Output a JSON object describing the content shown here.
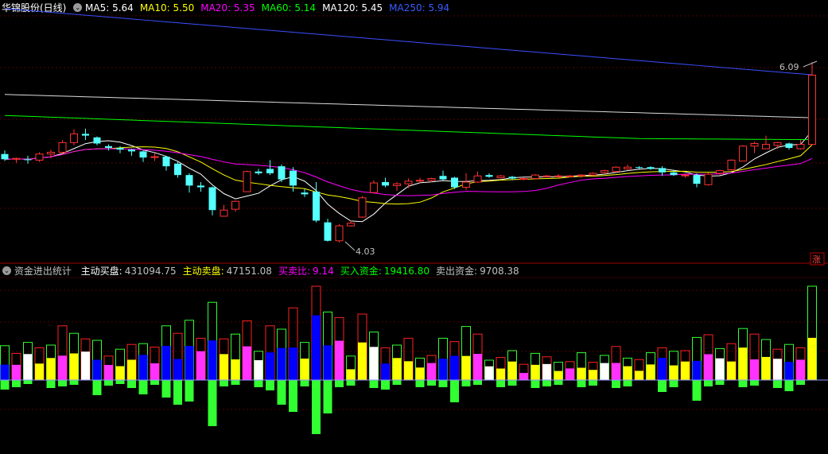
{
  "main_panel": {
    "title": "华锦股份(日线)",
    "ma_indicators": [
      {
        "label": "MA5: 5.64",
        "color": "#ffffff"
      },
      {
        "label": "MA10: 5.50",
        "color": "#ffff00"
      },
      {
        "label": "MA20: 5.35",
        "color": "#ff00ff"
      },
      {
        "label": "MA60: 5.14",
        "color": "#00ff00"
      },
      {
        "label": "MA120: 5.45",
        "color": "#ffffff"
      },
      {
        "label": "MA250: 5.94",
        "color": "#3a5bff"
      }
    ],
    "high_label": "6.09",
    "low_label": "4.03",
    "rise_badge": "涨"
  },
  "sub_panel": {
    "title": "资金进出统计",
    "indicators": [
      {
        "label": "主动买盘:",
        "value": "431094.75",
        "label_color": "#ffffff",
        "value_color": "#c0c0c0"
      },
      {
        "label": "主动卖盘:",
        "value": "47151.08",
        "label_color": "#ffff00",
        "value_color": "#c0c0c0"
      },
      {
        "label": "买卖比:",
        "value": "9.14",
        "label_color": "#ff00ff",
        "value_color": "#ff00ff"
      },
      {
        "label": "买入资金:",
        "value": "19416.80",
        "label_color": "#00ff00",
        "value_color": "#00ff00"
      },
      {
        "label": "卖出资金:",
        "value": "9708.38",
        "label_color": "#c0c0c0",
        "value_color": "#c0c0c0"
      }
    ]
  },
  "chart_data": {
    "type": "candlestick",
    "ohlc": [
      [
        5.04,
        5.08,
        4.96,
        4.98
      ],
      [
        4.98,
        5.0,
        4.94,
        4.99
      ],
      [
        4.98,
        5.02,
        4.93,
        4.97
      ],
      [
        4.97,
        5.06,
        4.95,
        5.04
      ],
      [
        5.04,
        5.09,
        4.99,
        5.06
      ],
      [
        5.06,
        5.2,
        5.03,
        5.17
      ],
      [
        5.17,
        5.32,
        5.14,
        5.27
      ],
      [
        5.27,
        5.33,
        5.2,
        5.25
      ],
      [
        5.23,
        5.24,
        5.14,
        5.16
      ],
      [
        5.13,
        5.15,
        5.08,
        5.11
      ],
      [
        5.11,
        5.13,
        5.05,
        5.09
      ],
      [
        5.09,
        5.1,
        5.02,
        5.07
      ],
      [
        5.07,
        5.08,
        4.95,
        5.0
      ],
      [
        5.0,
        5.05,
        4.96,
        5.01
      ],
      [
        5.01,
        5.02,
        4.85,
        4.9
      ],
      [
        4.93,
        4.95,
        4.77,
        4.8
      ],
      [
        4.8,
        4.82,
        4.6,
        4.68
      ],
      [
        4.68,
        4.72,
        4.61,
        4.66
      ],
      [
        4.66,
        4.67,
        4.34,
        4.4
      ],
      [
        4.33,
        4.46,
        4.33,
        4.4
      ],
      [
        4.41,
        4.51,
        4.38,
        4.5
      ],
      [
        4.61,
        4.85,
        4.61,
        4.84
      ],
      [
        4.84,
        4.87,
        4.8,
        4.82
      ],
      [
        4.87,
        4.97,
        4.8,
        4.82
      ],
      [
        4.9,
        4.92,
        4.72,
        4.75
      ],
      [
        4.85,
        4.89,
        4.61,
        4.68
      ],
      [
        4.6,
        4.64,
        4.55,
        4.58
      ],
      [
        4.61,
        4.72,
        4.26,
        4.28
      ],
      [
        4.26,
        4.3,
        4.04,
        4.05
      ],
      [
        4.05,
        4.24,
        4.03,
        4.22
      ],
      [
        4.22,
        4.28,
        4.21,
        4.25
      ],
      [
        4.32,
        4.56,
        4.31,
        4.54
      ],
      [
        4.6,
        4.74,
        4.6,
        4.71
      ],
      [
        4.72,
        4.77,
        4.66,
        4.68
      ],
      [
        4.68,
        4.72,
        4.62,
        4.7
      ],
      [
        4.7,
        4.76,
        4.65,
        4.73
      ],
      [
        4.73,
        4.77,
        4.71,
        4.74
      ],
      [
        4.74,
        4.77,
        4.72,
        4.76
      ],
      [
        4.79,
        4.85,
        4.74,
        4.75
      ],
      [
        4.77,
        4.78,
        4.64,
        4.66
      ],
      [
        4.66,
        4.82,
        4.63,
        4.72
      ],
      [
        4.72,
        4.84,
        4.71,
        4.79
      ],
      [
        4.8,
        4.82,
        4.77,
        4.78
      ],
      [
        4.77,
        4.8,
        4.76,
        4.79
      ],
      [
        4.78,
        4.79,
        4.74,
        4.76
      ],
      [
        4.76,
        4.77,
        4.74,
        4.76
      ],
      [
        4.76,
        4.81,
        4.75,
        4.8
      ],
      [
        4.79,
        4.8,
        4.78,
        4.79
      ],
      [
        4.79,
        4.81,
        4.77,
        4.79
      ],
      [
        4.79,
        4.8,
        4.78,
        4.79
      ],
      [
        4.79,
        4.81,
        4.77,
        4.8
      ],
      [
        4.8,
        4.83,
        4.79,
        4.82
      ],
      [
        4.83,
        4.86,
        4.81,
        4.85
      ],
      [
        4.84,
        4.9,
        4.83,
        4.89
      ],
      [
        4.87,
        4.92,
        4.86,
        4.89
      ],
      [
        4.89,
        4.9,
        4.87,
        4.88
      ],
      [
        4.89,
        4.9,
        4.86,
        4.87
      ],
      [
        4.88,
        4.9,
        4.79,
        4.83
      ],
      [
        4.83,
        4.86,
        4.79,
        4.8
      ],
      [
        4.8,
        4.82,
        4.77,
        4.8
      ],
      [
        4.8,
        4.82,
        4.66,
        4.7
      ],
      [
        4.69,
        4.83,
        4.68,
        4.81
      ],
      [
        4.82,
        4.86,
        4.8,
        4.85
      ],
      [
        4.86,
        4.98,
        4.85,
        4.97
      ],
      [
        4.96,
        5.14,
        4.96,
        5.13
      ],
      [
        5.13,
        5.18,
        5.05,
        5.16
      ],
      [
        5.1,
        5.25,
        5.1,
        5.15
      ],
      [
        5.14,
        5.18,
        5.1,
        5.17
      ],
      [
        5.16,
        5.17,
        5.09,
        5.11
      ],
      [
        5.1,
        5.2,
        5.09,
        5.15
      ],
      [
        5.15,
        6.09,
        5.14,
        5.94
      ]
    ],
    "ma250": [
      5.94
    ],
    "flow_bars": [
      {
        "buy_total": 0.8,
        "buy_fill": 0.35,
        "sell": 0.2
      },
      {
        "buy_total": 0.8,
        "buy_fill": 0.3,
        "sell": 0.1
      }
    ]
  }
}
